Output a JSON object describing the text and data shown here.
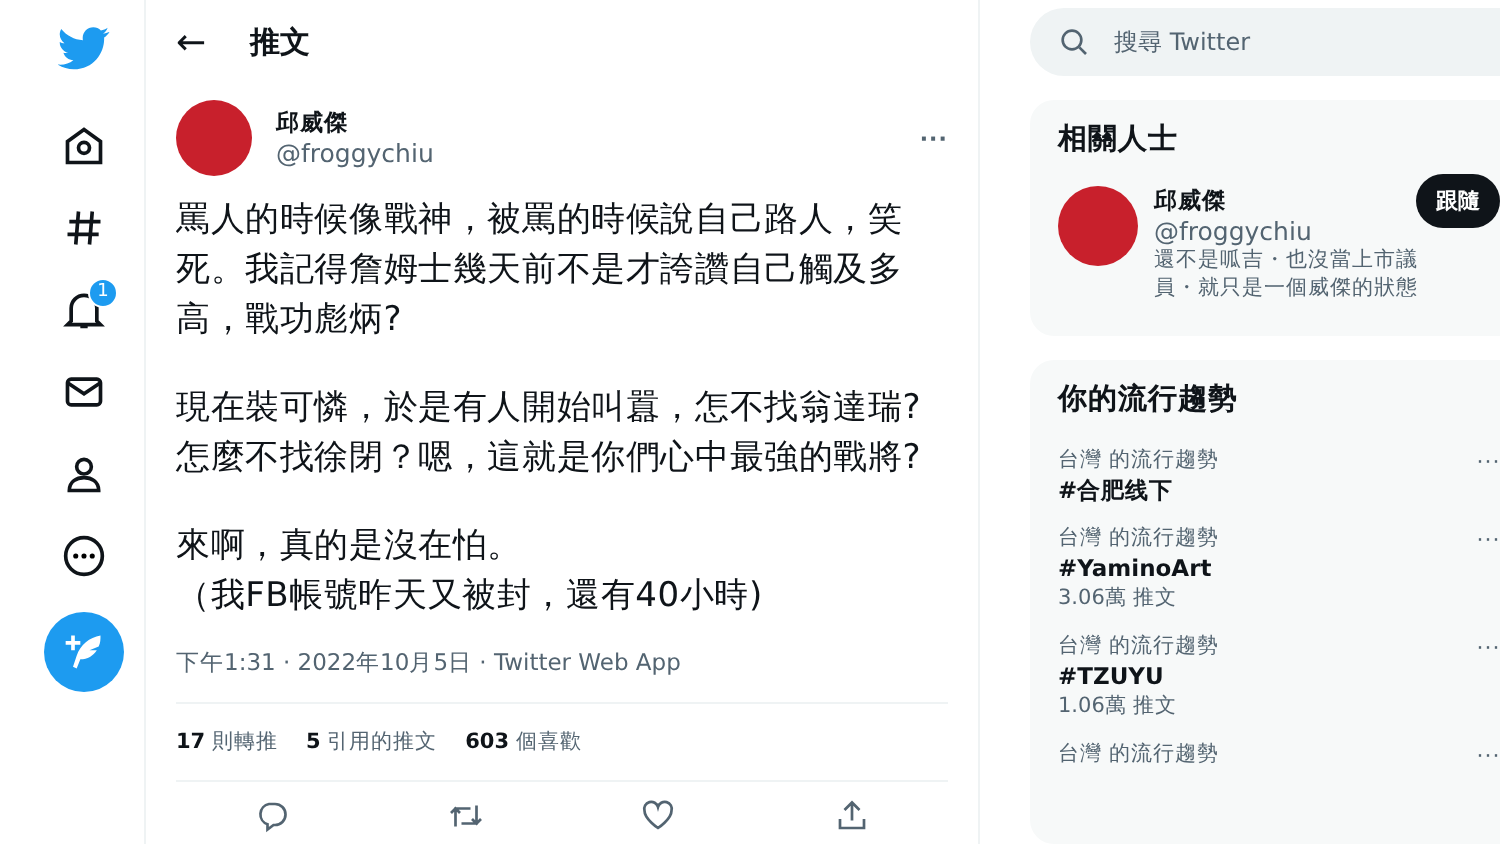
{
  "nav": {
    "notification_badge": "1"
  },
  "header": {
    "back": "←",
    "title": "推文"
  },
  "tweet": {
    "author": {
      "name": "邱威傑",
      "handle": "@froggychiu"
    },
    "more": "···",
    "paragraphs": [
      [
        "罵人的時候像戰神，被罵的時候說自己路人，笑",
        "死。我記得詹姆士幾天前不是才誇讚自己觸及多",
        "高，戰功彪炳?"
      ],
      [
        "現在裝可憐，於是有人開始叫囂，怎不找翁達瑞?",
        "怎麼不找徐閉？嗯，這就是你們心中最強的戰將?"
      ],
      [
        "來啊，真的是沒在怕。",
        "（我FB帳號昨天又被封，還有40小時)"
      ]
    ],
    "meta": "下午1:31 · 2022年10月5日 · Twitter Web App",
    "stats": [
      {
        "count": "17",
        "label": "則轉推"
      },
      {
        "count": "5",
        "label": "引用的推文"
      },
      {
        "count": "603",
        "label": "個喜歡"
      }
    ]
  },
  "search": {
    "placeholder": "搜尋 Twitter"
  },
  "related": {
    "title": "相關人士",
    "person": {
      "name": "邱威傑",
      "handle": "@froggychiu",
      "bio": "還不是呱吉・也沒當上市議員・就只是一個威傑的狀態",
      "follow": "跟隨"
    }
  },
  "trends": {
    "title": "你的流行趨勢",
    "items": [
      {
        "context": "台灣 的流行趨勢",
        "tag": "#合肥线下",
        "more": "···"
      },
      {
        "context": "台灣 的流行趨勢",
        "tag": "#YaminoArt",
        "count": "3.06萬 推文",
        "more": "···"
      },
      {
        "context": "台灣 的流行趨勢",
        "tag": "#TZUYU",
        "count": "1.06萬 推文",
        "more": "···"
      },
      {
        "context": "台灣 的流行趨勢",
        "more": "···"
      }
    ]
  }
}
